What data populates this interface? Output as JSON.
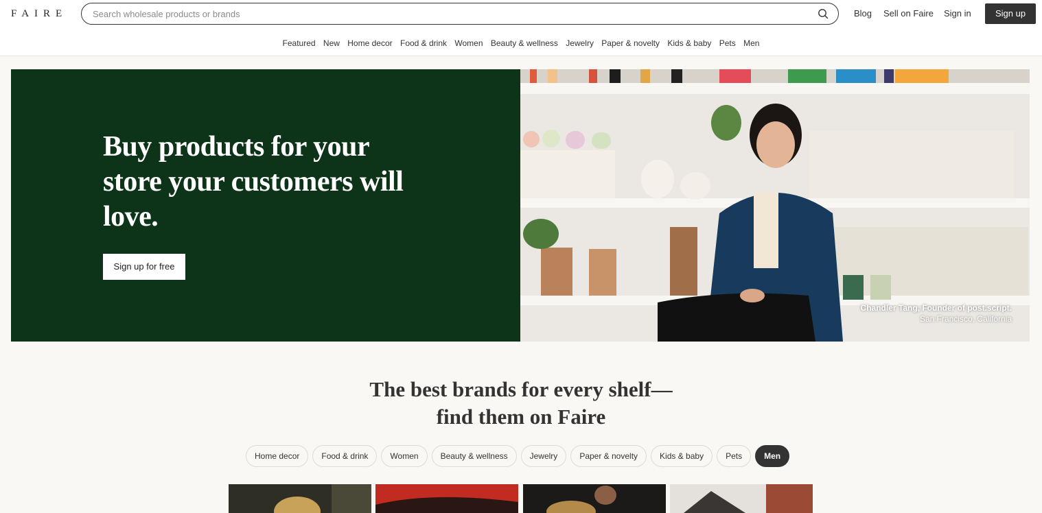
{
  "header": {
    "logo": "FAIRE",
    "search_placeholder": "Search wholesale products or brands",
    "links": {
      "blog": "Blog",
      "sell": "Sell on Faire",
      "signin": "Sign in"
    },
    "signup": "Sign up"
  },
  "categories": [
    "Featured",
    "New",
    "Home decor",
    "Food & drink",
    "Women",
    "Beauty & wellness",
    "Jewelry",
    "Paper & novelty",
    "Kids & baby",
    "Pets",
    "Men"
  ],
  "hero": {
    "title": "Buy products for your store your customers will love.",
    "button": "Sign up for free",
    "caption_name": "Chandler Tang, Founder of post.script.",
    "caption_location": "San Francisco, California"
  },
  "brands_section": {
    "title_line1": "The best brands for every shelf—",
    "title_line2": "find them on Faire",
    "pills": [
      "Home decor",
      "Food & drink",
      "Women",
      "Beauty & wellness",
      "Jewelry",
      "Paper & novelty",
      "Kids & baby",
      "Pets",
      "Men"
    ],
    "active_pill": "Men"
  },
  "colors": {
    "hero_green": "#0d3319",
    "dark": "#333333",
    "page_bg": "#faf8f5"
  }
}
